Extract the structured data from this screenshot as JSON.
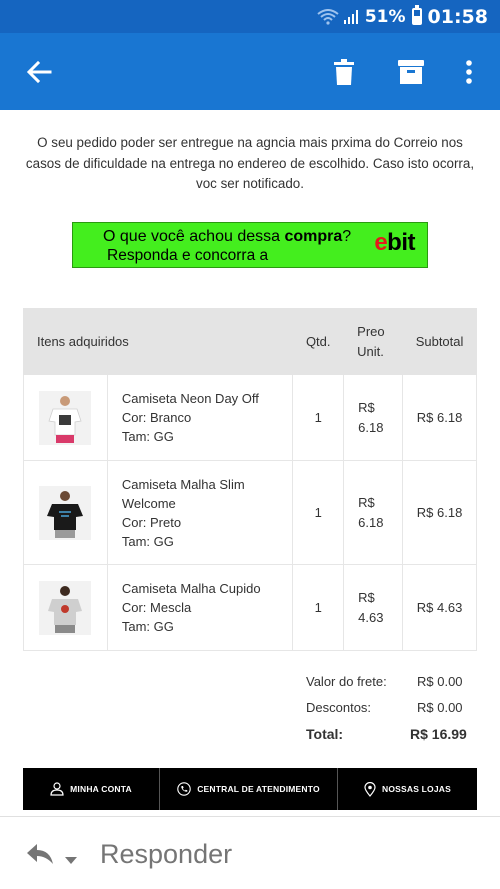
{
  "status_bar": {
    "battery_percent_label": "51%",
    "battery_level": 0.51,
    "time": "01:58",
    "icons": [
      "wifi-icon",
      "signal-icon",
      "battery-icon"
    ]
  },
  "app_bar": {
    "icons": [
      "back-arrow-icon",
      "trash-icon",
      "archive-icon",
      "more-vert-icon"
    ],
    "color": "#1976d2"
  },
  "email": {
    "notice_text": "O seu pedido poder ser entregue na agncia mais prxima do Correio nos casos de dificuldade na entrega no endereo de escolhido. Caso isto ocorra, voc ser notificado.",
    "ebit_banner": {
      "question_prefix": "O que você achou dessa ",
      "question_bold": "compra",
      "question_suffix": "?",
      "answer": "Responda e concorra a",
      "logo_e": "e",
      "logo_rest": "bit"
    },
    "table": {
      "headers": {
        "items": "Itens adquiridos",
        "qty": "Qtd.",
        "price_line1": "Preo",
        "price_line2": "Unit.",
        "subtotal": "Subtotal"
      },
      "rows": [
        {
          "name_lines": [
            "Camiseta Neon Day Off",
            "Cor: Branco",
            "Tam: GG"
          ],
          "qty": "1",
          "price_line1": "R$",
          "price_line2": "6.18",
          "subtotal": "R$ 6.18"
        },
        {
          "name_lines": [
            "Camiseta Malha Slim",
            "Welcome",
            "Cor: Preto",
            "Tam: GG"
          ],
          "qty": "1",
          "price_line1": "R$",
          "price_line2": "6.18",
          "subtotal": "R$ 6.18"
        },
        {
          "name_lines": [
            "Camiseta Malha Cupido",
            "Cor: Mescla",
            "Tam: GG"
          ],
          "qty": "1",
          "price_line1": "R$",
          "price_line2": "4.63",
          "subtotal": "R$ 4.63"
        }
      ]
    },
    "totals": {
      "shipping_label": "Valor do frete:",
      "shipping_value": "R$ 0.00",
      "discount_label": "Descontos:",
      "discount_value": "R$ 0.00",
      "total_label": "Total:",
      "total_value": "R$ 16.99"
    },
    "footer_nav": {
      "account": "MINHA CONTA",
      "support": "CENTRAL DE ATENDIMENTO",
      "stores": "NOSSAS LOJAS"
    }
  },
  "reply_bar": {
    "label": "Responder"
  }
}
